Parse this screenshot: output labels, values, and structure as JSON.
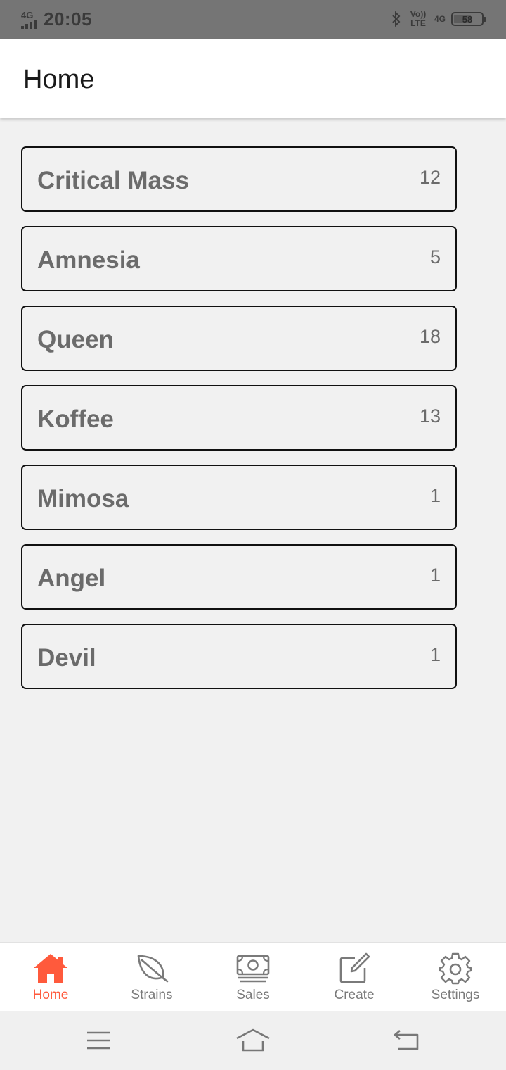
{
  "status_bar": {
    "network_label": "4G",
    "time": "20:05",
    "volte_label": "Vo)) LTE",
    "data_label": "4G",
    "battery_level": "58"
  },
  "app_bar": {
    "title": "Home"
  },
  "strains": [
    {
      "name": "Critical Mass",
      "count": "12"
    },
    {
      "name": "Amnesia",
      "count": "5"
    },
    {
      "name": "Queen",
      "count": "18"
    },
    {
      "name": "Koffee",
      "count": "13"
    },
    {
      "name": "Mimosa",
      "count": "1"
    },
    {
      "name": "Angel",
      "count": "1"
    },
    {
      "name": "Devil",
      "count": "1"
    }
  ],
  "bottom_nav": {
    "items": [
      {
        "label": "Home",
        "icon": "home-icon",
        "active": true
      },
      {
        "label": "Strains",
        "icon": "leaf-icon",
        "active": false
      },
      {
        "label": "Sales",
        "icon": "money-icon",
        "active": false
      },
      {
        "label": "Create",
        "icon": "edit-icon",
        "active": false
      },
      {
        "label": "Settings",
        "icon": "gear-icon",
        "active": false
      }
    ]
  },
  "system_nav": {
    "icons": [
      "menu-icon",
      "home-outline-icon",
      "back-icon"
    ]
  },
  "colors": {
    "accent": "#ff5a3c",
    "inactive": "#7a7a7a",
    "card_text": "#6b6b6b",
    "background": "#f1f1f1"
  }
}
